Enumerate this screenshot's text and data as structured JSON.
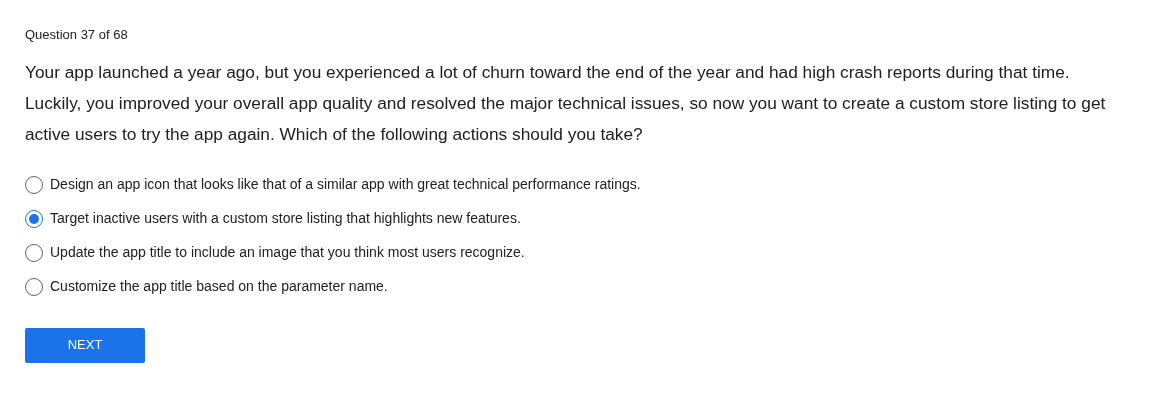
{
  "question_counter": "Question 37 of 68",
  "question": "Your app launched a year ago, but you experienced a lot of churn toward the end of the year and had high crash reports during that time. Luckily, you improved your overall app quality and resolved the major technical issues, so now you want to create a custom store listing to get active users to try the app again. Which of the following actions should you take?",
  "options": [
    {
      "label": "Design an app icon that looks like that of a similar app with great technical performance ratings.",
      "selected": false
    },
    {
      "label": "Target inactive users with a custom store listing that highlights new features.",
      "selected": true
    },
    {
      "label": "Update the app title to include an image that you think most users recognize.",
      "selected": false
    },
    {
      "label": "Customize the app title based on the parameter name.",
      "selected": false
    }
  ],
  "next_button": "NEXT"
}
